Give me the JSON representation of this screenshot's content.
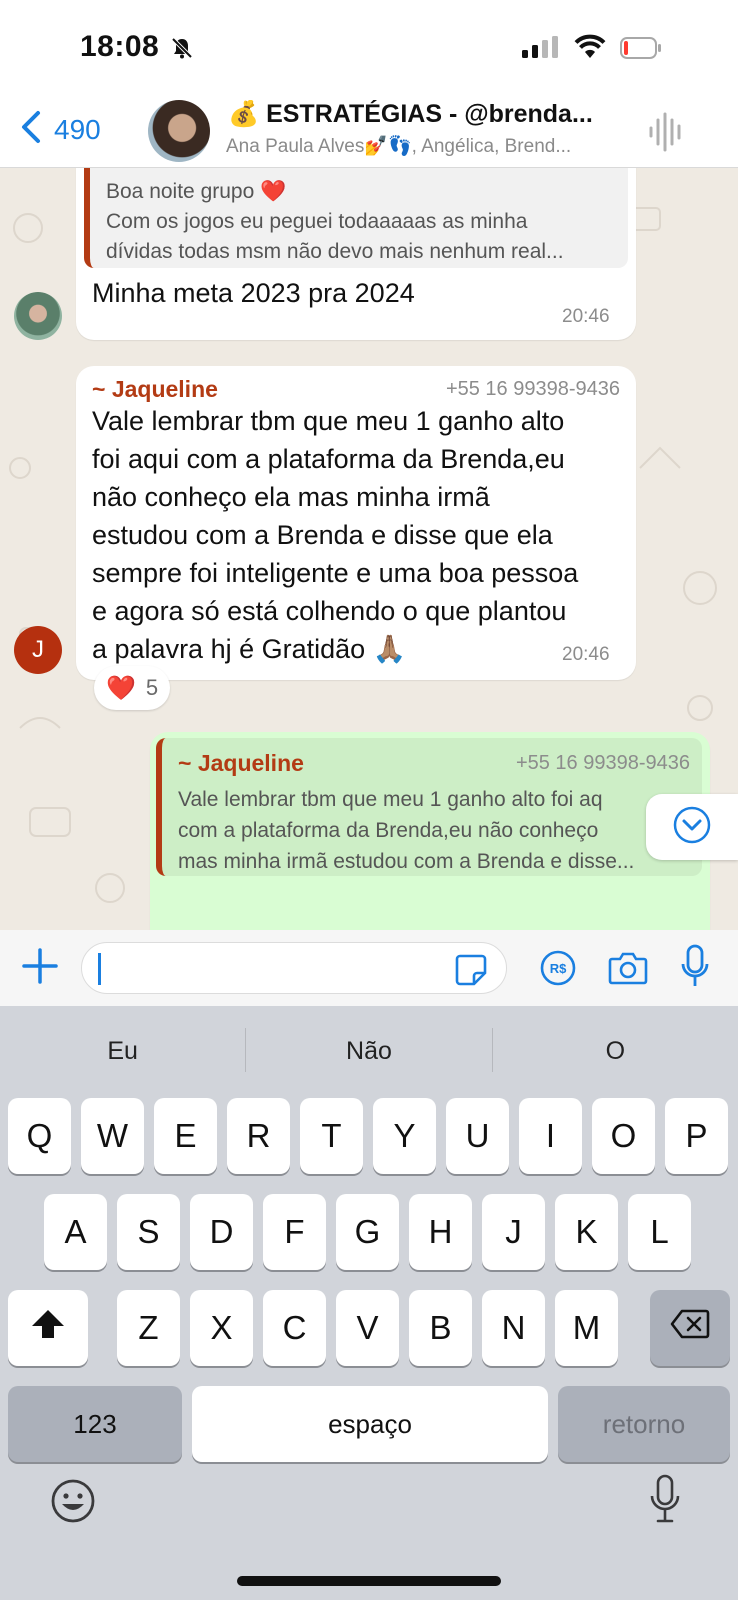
{
  "status_bar": {
    "time": "18:08"
  },
  "header": {
    "back_count": "490",
    "title": "💰 ESTRATÉGIAS - @brenda...",
    "members": "Ana Paula Alves💅👣, Angélica, Brend..."
  },
  "messages": {
    "m1": {
      "quote_line1": "Boa noite grupo ❤️",
      "quote_line2": "Com os jogos eu peguei todaaaaas as minha",
      "quote_line3": "dívidas todas msm não devo mais nenhum real...",
      "text": "Minha meta 2023 pra 2024",
      "time": "20:46"
    },
    "m2": {
      "avatar_letter": "J",
      "sender": "~ Jaqueline",
      "phone": "+55 16 99398-9436",
      "lines": [
        "Vale lembrar tbm que meu 1 ganho alto",
        "foi aqui com a plataforma da Brenda,eu",
        "não conheço ela mas minha irmã",
        "estudou com a Brenda e disse que ela",
        "sempre foi inteligente e uma boa pessoa",
        "e agora só está colhendo o que plantou",
        "a palavra hj é Gratidão 🙏🏽"
      ],
      "time": "20:46",
      "reaction_emoji": "❤️",
      "reaction_count": "5"
    },
    "m3": {
      "sender": "~ Jaqueline",
      "phone": "+55 16 99398-9436",
      "line1": "Vale lembrar tbm que meu 1 ganho alto foi aq",
      "line2": "com a plataforma da Brenda,eu não conheço",
      "line3": "mas minha irmã estudou com a Brenda e disse..."
    }
  },
  "keyboard": {
    "suggestions": [
      "Eu",
      "Não",
      "O"
    ],
    "row1": [
      "Q",
      "W",
      "E",
      "R",
      "T",
      "Y",
      "U",
      "I",
      "O",
      "P"
    ],
    "row2": [
      "A",
      "S",
      "D",
      "F",
      "G",
      "H",
      "J",
      "K",
      "L"
    ],
    "row3": [
      "Z",
      "X",
      "C",
      "V",
      "B",
      "N",
      "M"
    ],
    "numbers_label": "123",
    "space_label": "espaço",
    "return_label": "retorno"
  },
  "colors": {
    "accent": "#1a7fe0",
    "sender": "#b33b14",
    "outgoing": "#d9fdd3"
  }
}
